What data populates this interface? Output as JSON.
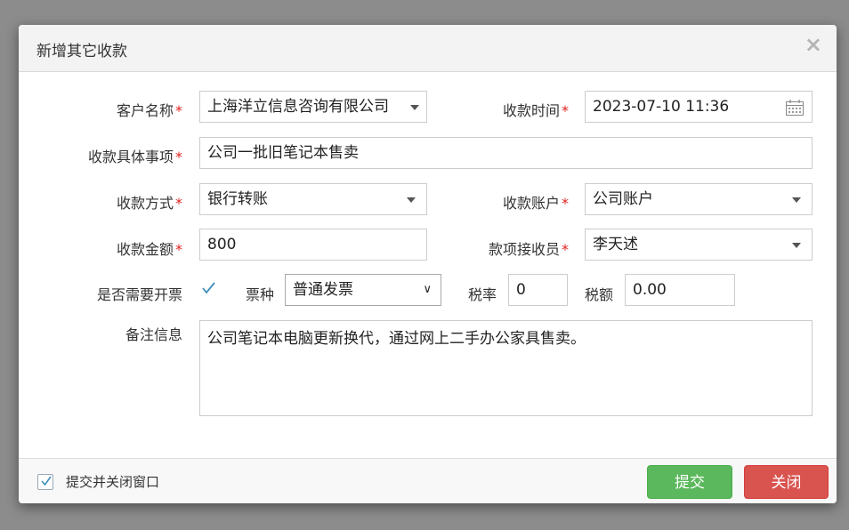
{
  "dialog": {
    "title": "新增其它收款",
    "close_glyph": "×"
  },
  "form": {
    "customer": {
      "label": "客户名称",
      "value": "上海洋立信息咨询有限公司",
      "required_mark": "*"
    },
    "receipt_time": {
      "label": "收款时间",
      "value": "2023-07-10 11:36",
      "required_mark": "*"
    },
    "item": {
      "label": "收款具体事项",
      "value": "公司一批旧笔记本售卖",
      "required_mark": "*"
    },
    "method": {
      "label": "收款方式",
      "value": "银行转账",
      "required_mark": "*"
    },
    "account": {
      "label": "收款账户",
      "value": "公司账户",
      "required_mark": "*"
    },
    "amount": {
      "label": "收款金额",
      "value": "800",
      "required_mark": "*"
    },
    "receiver": {
      "label": "款项接收员",
      "value": "李天述",
      "required_mark": "*"
    },
    "invoice": {
      "label": "是否需要开票",
      "checked": true
    },
    "invoice_type": {
      "label": "票种",
      "value": "普通发票",
      "chevron": "∨"
    },
    "tax_rate": {
      "label": "税率",
      "value": "0"
    },
    "tax_amount": {
      "label": "税额",
      "value": "0.00"
    },
    "remark": {
      "label": "备注信息",
      "value": "公司笔记本电脑更新换代，通过网上二手办公家具售卖。"
    }
  },
  "footer": {
    "close_after_submit": {
      "label": "提交并关闭窗口",
      "checked": true
    },
    "submit_label": "提交",
    "close_label": "关闭"
  },
  "colors": {
    "submit": "#5cb85c",
    "close": "#d9534f",
    "required": "#e02020",
    "check": "#3c8dbc"
  }
}
